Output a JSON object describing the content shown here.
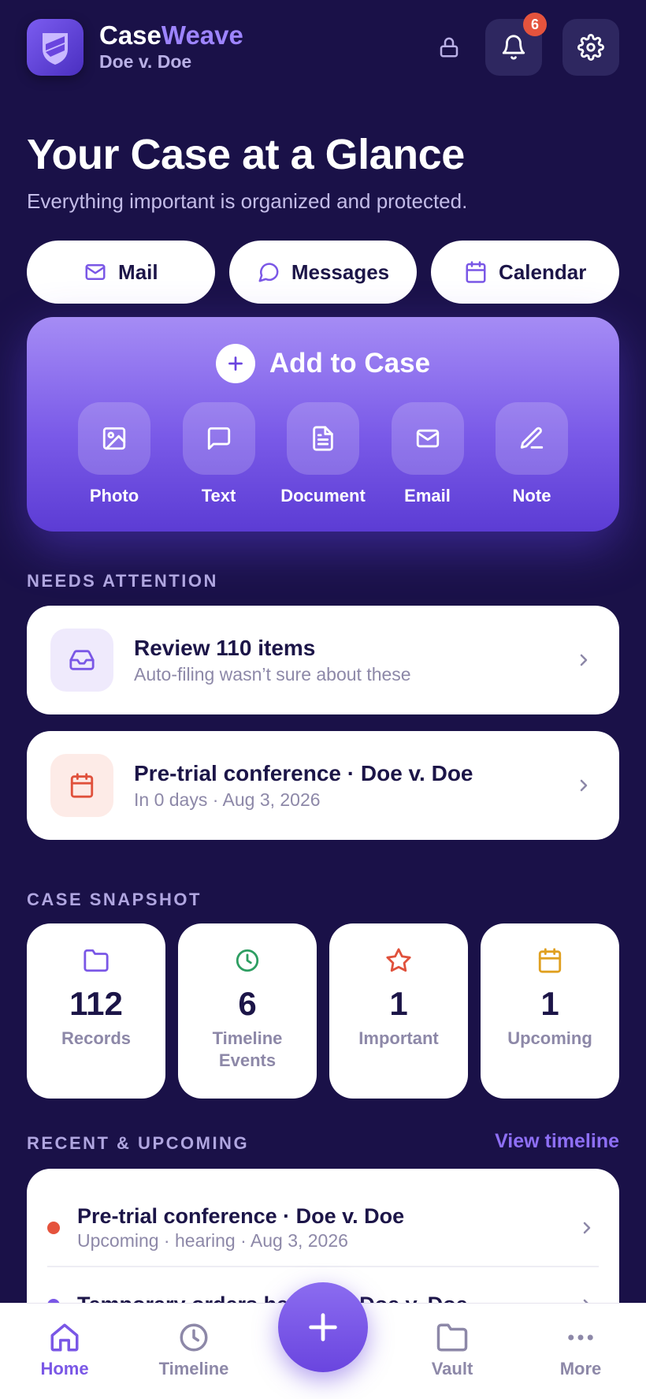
{
  "header": {
    "brand_part1": "Case",
    "brand_part2": "Weave",
    "case_name": "Doe v. Doe",
    "notification_count": "6"
  },
  "hero": {
    "title": "Your Case at a Glance",
    "subtitle": "Everything important is organized and protected."
  },
  "quick_actions": [
    {
      "label": "Mail",
      "icon": "mail-icon"
    },
    {
      "label": "Messages",
      "icon": "chat-bubble-icon"
    },
    {
      "label": "Calendar",
      "icon": "calendar-icon"
    }
  ],
  "add_to_case": {
    "title": "Add to Case",
    "items": [
      {
        "label": "Photo",
        "icon": "image-icon"
      },
      {
        "label": "Text",
        "icon": "message-square-icon"
      },
      {
        "label": "Document",
        "icon": "document-icon"
      },
      {
        "label": "Email",
        "icon": "mail-icon"
      },
      {
        "label": "Note",
        "icon": "pen-icon"
      }
    ]
  },
  "needs_attention": {
    "label": "NEEDS ATTENTION",
    "items": [
      {
        "title": "Review 110 items",
        "subtitle": "Auto-filing wasn’t sure about these",
        "icon": "inbox-icon"
      },
      {
        "title": "Pre-trial conference · Doe v. Doe",
        "subtitle": "In 0 days · Aug 3, 2026",
        "icon": "calendar-icon"
      }
    ]
  },
  "snapshot": {
    "label": "CASE SNAPSHOT",
    "items": [
      {
        "value": "112",
        "label": "Records",
        "icon": "folder-icon"
      },
      {
        "value": "6",
        "label": "Timeline Events",
        "icon": "clock-icon"
      },
      {
        "value": "1",
        "label": "Important",
        "icon": "star-icon"
      },
      {
        "value": "1",
        "label": "Upcoming",
        "icon": "calendar-icon"
      }
    ]
  },
  "recent": {
    "label": "RECENT & UPCOMING",
    "view_link": "View timeline",
    "items": [
      {
        "title": "Pre-trial conference · Doe v. Doe",
        "subtitle": "Upcoming · hearing · Aug 3, 2026"
      },
      {
        "title": "Temporary orders hearing · Doe v. Doe",
        "subtitle": ""
      }
    ]
  },
  "nav": {
    "items": [
      {
        "label": "Home",
        "icon": "home-icon"
      },
      {
        "label": "Timeline",
        "icon": "clock-icon"
      },
      {
        "label": "Vault",
        "icon": "folder-icon"
      },
      {
        "label": "More",
        "icon": "more-dots-icon"
      }
    ]
  },
  "colors": {
    "background": "#1a1148",
    "accent": "#7a57e6",
    "brand_light": "#9d84ff",
    "alert": "#e5533d"
  }
}
